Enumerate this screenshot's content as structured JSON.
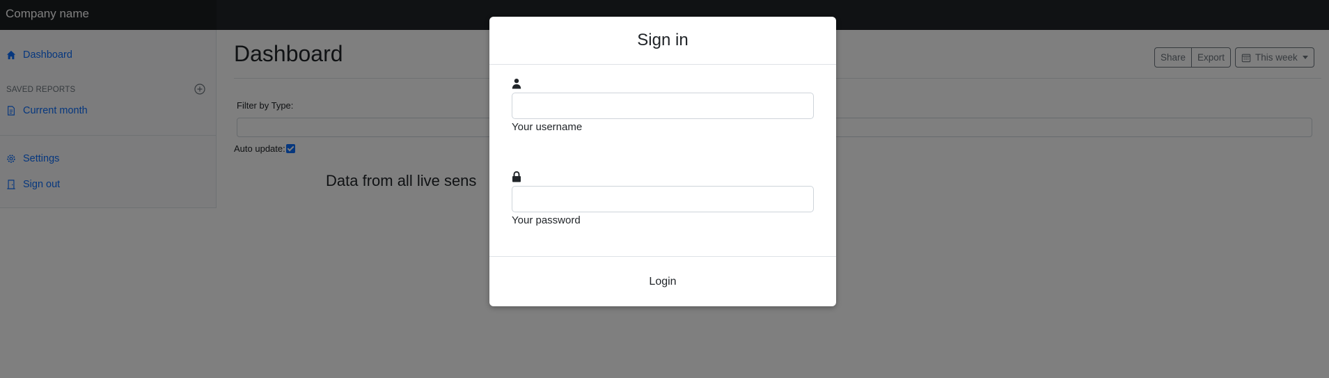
{
  "header": {
    "brand": "Company name"
  },
  "sidebar": {
    "items": [
      {
        "label": "Dashboard",
        "icon": "home-icon"
      },
      {
        "label": "Current month",
        "icon": "file-text-icon"
      },
      {
        "label": "Settings",
        "icon": "gear-icon"
      },
      {
        "label": "Sign out",
        "icon": "door-icon"
      }
    ],
    "saved_reports_heading": "SAVED REPORTS",
    "add_report_icon": "plus-circle-icon"
  },
  "main": {
    "title": "Dashboard",
    "toolbar": {
      "share": "Share",
      "export": "Export",
      "range": "This week",
      "range_icon": "calendar-icon"
    },
    "filter_label": "Filter by Type:",
    "filter_value": "",
    "auto_update_label": "Auto update:",
    "auto_update_checked": true,
    "chart_heading": "Data from all live sens"
  },
  "modal": {
    "title": "Sign in",
    "username": {
      "icon": "user-icon",
      "value": "",
      "help": "Your username"
    },
    "password": {
      "icon": "lock-icon",
      "value": "",
      "help": "Your password"
    },
    "login_label": "Login"
  },
  "colors": {
    "topbar": "#212529",
    "link": "#0d6efd",
    "backdrop": "rgba(0,0,0,0.5)",
    "modal_bg": "#ffffff"
  }
}
